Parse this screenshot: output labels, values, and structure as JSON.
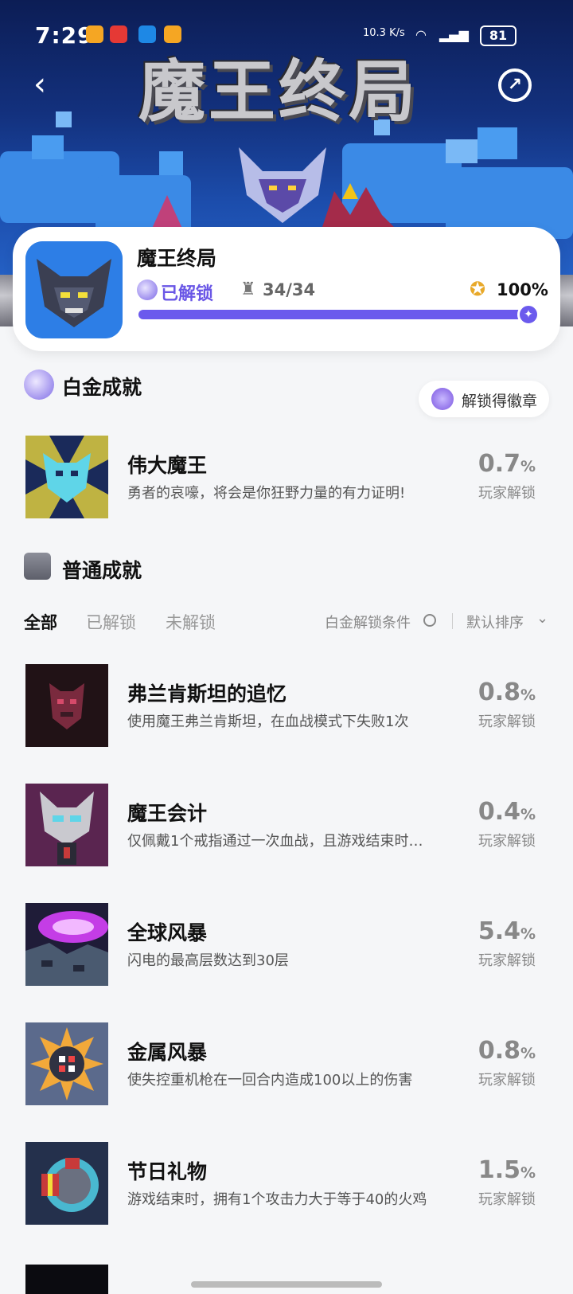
{
  "status_bar": {
    "time": "7:29",
    "battery": "81",
    "net_speed": "10.3 K/s"
  },
  "header": {
    "game_logo_text": "魔王终局",
    "back_icon": "back-arrow-icon",
    "share_icon": "share-icon"
  },
  "game_card": {
    "title": "魔王终局",
    "unlocked_label": "已解锁",
    "trophy_count": "34/34",
    "percent": "100%",
    "progress": 1.0,
    "accent_color": "#6b5aed"
  },
  "platinum_section": {
    "title": "白金成就",
    "badge_button": "解锁得徽章",
    "achievement": {
      "name": "伟大魔王",
      "desc": "勇者的哀嚎，将会是你狂野力量的有力证明!",
      "pct_value": "0.7",
      "pct_unit": "%",
      "pct_label": "玩家解锁"
    }
  },
  "normal_section": {
    "title": "普通成就",
    "tabs": [
      "全部",
      "已解锁",
      "未解锁"
    ],
    "platinum_condition": "白金解锁条件",
    "sort_label": "默认排序",
    "achievements": [
      {
        "name": "弗兰肯斯坦的追忆",
        "desc": "使用魔王弗兰肯斯坦，在血战模式下失败1次",
        "pct_value": "0.8",
        "pct_unit": "%",
        "pct_label": "玩家解锁"
      },
      {
        "name": "魔王会计",
        "desc": "仅佩戴1个戒指通过一次血战，且游戏结束时…",
        "pct_value": "0.4",
        "pct_unit": "%",
        "pct_label": "玩家解锁"
      },
      {
        "name": "全球风暴",
        "desc": "闪电的最高层数达到30层",
        "pct_value": "5.4",
        "pct_unit": "%",
        "pct_label": "玩家解锁"
      },
      {
        "name": "金属风暴",
        "desc": "使失控重机枪在一回合内造成100以上的伤害",
        "pct_value": "0.8",
        "pct_unit": "%",
        "pct_label": "玩家解锁"
      },
      {
        "name": "节日礼物",
        "desc": "游戏结束时，拥有1个攻击力大于等于40的火鸡",
        "pct_value": "1.5",
        "pct_unit": "%",
        "pct_label": "玩家解锁"
      }
    ]
  }
}
